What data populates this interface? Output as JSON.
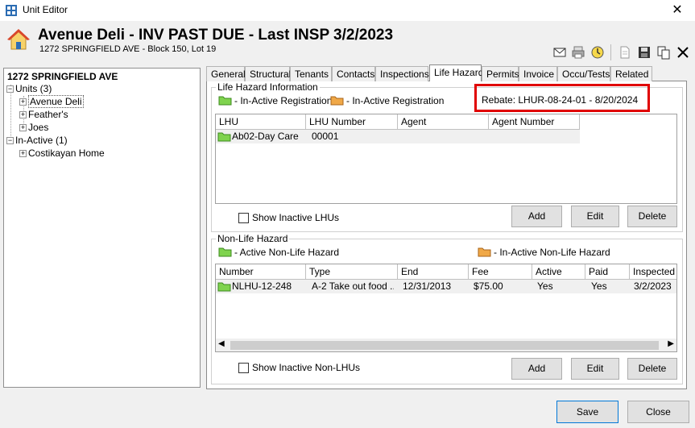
{
  "window": {
    "title": "Unit Editor"
  },
  "header": {
    "title": "Avenue Deli - INV PAST DUE - Last INSP 3/2/2023",
    "subtitle": "1272 SPRINGFIELD AVE - Block 150, Lot 19"
  },
  "tree": {
    "root": "1272 SPRINGFIELD AVE",
    "units_label": "Units (3)",
    "units": [
      "Avenue Deli",
      "Feather's",
      "Joes"
    ],
    "inactive_label": "In-Active (1)",
    "inactive": [
      "Costikayan Home"
    ]
  },
  "tabs": [
    "General",
    "Structural",
    "Tenants",
    "Contacts",
    "Inspections",
    "Life Hazard",
    "Permits",
    "Invoice",
    "Occu/Tests",
    "Related"
  ],
  "life_hazard": {
    "group_title": "Life Hazard Information",
    "legend_active": "- In-Active Registration",
    "legend_inactive": "- In-Active Registration",
    "rebate": "Rebate: LHUR-08-24-01 - 8/20/2024",
    "columns": [
      "LHU",
      "LHU Number",
      "Agent",
      "Agent Number"
    ],
    "rows": [
      {
        "lhu": "Ab02-Day Care",
        "number": "00001",
        "agent": "",
        "agent_number": ""
      }
    ],
    "show_inactive_label": "Show Inactive LHUs",
    "add": "Add",
    "edit": "Edit",
    "delete": "Delete"
  },
  "non_life_hazard": {
    "group_title": "Non-Life Hazard",
    "legend_active": "- Active Non-Life Hazard",
    "legend_inactive": "- In-Active Non-Life Hazard",
    "columns": [
      "Number",
      "Type",
      "End",
      "Fee",
      "Active",
      "Paid",
      "Inspected"
    ],
    "rows": [
      {
        "number": "NLHU-12-248",
        "type": "A-2 Take out food ...",
        "end": "12/31/2013",
        "fee": "$75.00",
        "active": "Yes",
        "paid": "Yes",
        "inspected": "3/2/2023"
      }
    ],
    "show_inactive_label": "Show Inactive Non-LHUs",
    "add": "Add",
    "edit": "Edit",
    "delete": "Delete"
  },
  "footer": {
    "save": "Save",
    "close": "Close"
  },
  "colors": {
    "folder_active": "#7fd34e",
    "folder_inactive": "#f0a847",
    "rebate_border": "#e00000"
  }
}
